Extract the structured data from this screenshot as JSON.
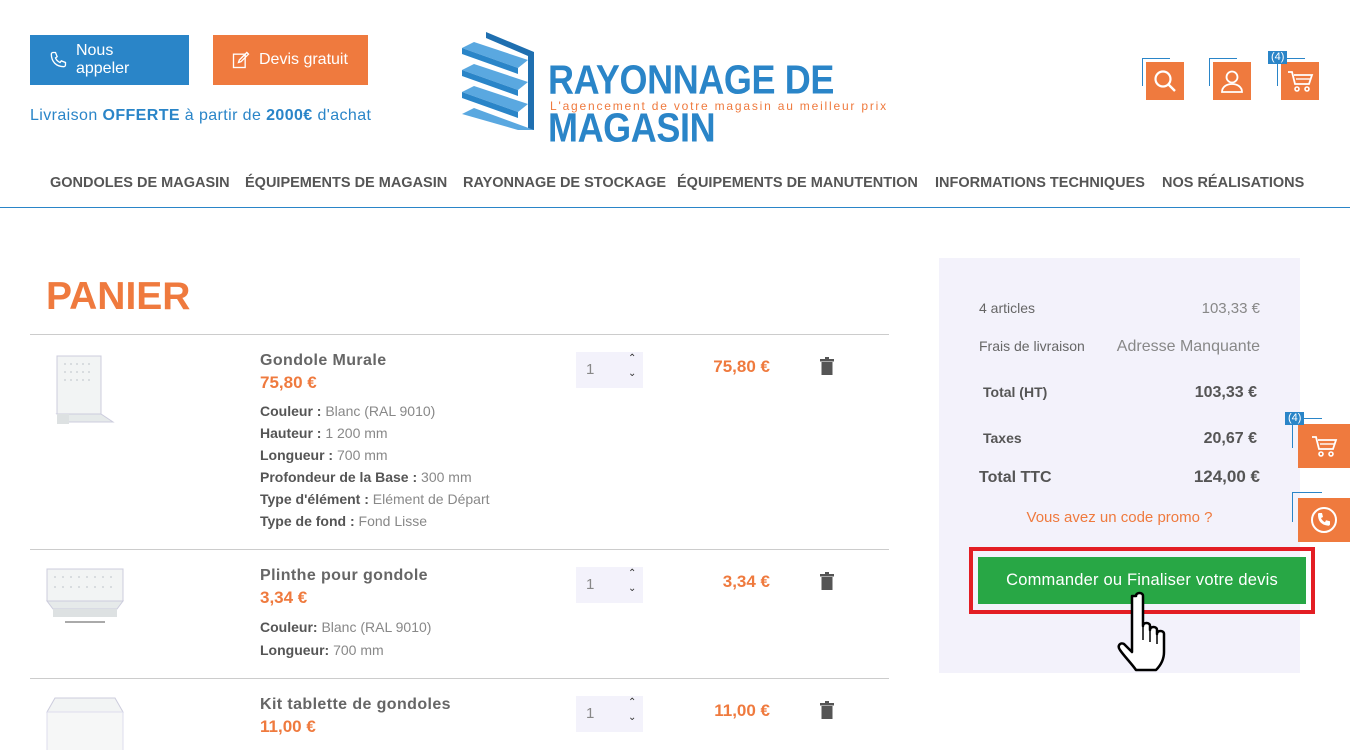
{
  "header": {
    "call_label": "Nous appeler",
    "quote_label": "Devis gratuit",
    "delivery_prefix": "Livraison ",
    "delivery_bold": "OFFERTE",
    "delivery_mid": " à partir de ",
    "delivery_amount": "2000€",
    "delivery_suffix": " d'achat",
    "logo_title": "RAYONNAGE DE MAGASIN",
    "logo_subtitle": "L'agencement de votre magasin au meilleur prix",
    "cart_count": "(4)"
  },
  "nav": [
    "GONDOLES DE MAGASIN",
    "ÉQUIPEMENTS DE MAGASIN",
    "RAYONNAGE DE STOCKAGE",
    "ÉQUIPEMENTS DE MANUTENTION",
    "INFORMATIONS TECHNIQUES",
    "NOS RÉALISATIONS"
  ],
  "cart": {
    "title": "PANIER",
    "items": [
      {
        "name": "Gondole Murale",
        "price": "75,80 €",
        "qty": "1",
        "total": "75,80 €",
        "attrs": [
          {
            "k": "Couleur :",
            "v": " Blanc (RAL 9010)"
          },
          {
            "k": "Hauteur :",
            "v": " 1 200 mm"
          },
          {
            "k": "Longueur :",
            "v": " 700 mm"
          },
          {
            "k": "Profondeur de la Base :",
            "v": " 300 mm"
          },
          {
            "k": "Type d'élément :",
            "v": " Elément de Départ"
          },
          {
            "k": "Type de fond :",
            "v": " Fond Lisse"
          }
        ]
      },
      {
        "name": "Plinthe pour gondole",
        "price": "3,34 €",
        "qty": "1",
        "total": "3,34 €",
        "attrs": [
          {
            "k": "Couleur:",
            "v": " Blanc (RAL 9010)"
          },
          {
            "k": "Longueur:",
            "v": " 700 mm"
          }
        ]
      },
      {
        "name": "Kit tablette de gondoles",
        "price": "11,00 €",
        "qty": "1",
        "total": "11,00 €",
        "attrs": []
      }
    ]
  },
  "summary": {
    "articles_label": "4 articles",
    "articles_value": "103,33 €",
    "shipping_label": "Frais de livraison",
    "shipping_value": "Adresse Manquante",
    "total_ht_label": "Total (HT)",
    "total_ht_value": "103,33 €",
    "taxes_label": "Taxes",
    "taxes_value": "20,67 €",
    "total_ttc_label": "Total TTC",
    "total_ttc_value": "124,00 €",
    "promo": "Vous avez un code promo ?",
    "cta": "Commander ou Finaliser votre devis"
  },
  "side": {
    "cart_count": "(4)"
  },
  "colors": {
    "brand_blue": "#2a85c8",
    "brand_orange": "#ef7a3e",
    "cta_green": "#28a745",
    "highlight_red": "#e31e24"
  }
}
